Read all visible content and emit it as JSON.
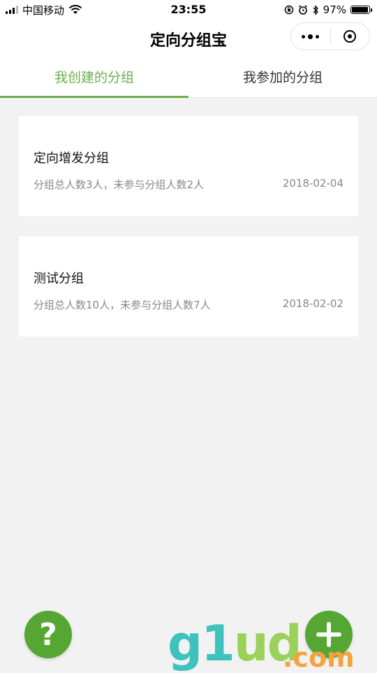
{
  "status_bar": {
    "carrier": "中国移动",
    "time": "23:55",
    "battery_percent": "97%",
    "battery_level": 0.97,
    "icons": [
      "signal-icon",
      "wifi-icon",
      "orientation-lock-icon",
      "alarm-icon",
      "bluetooth-icon",
      "battery-icon"
    ]
  },
  "navbar": {
    "title": "定向分组宝",
    "more_icon": "more-dots-icon",
    "close_icon": "target-icon"
  },
  "tabs": [
    {
      "label": "我创建的分组",
      "active": true
    },
    {
      "label": "我参加的分组",
      "active": false
    }
  ],
  "groups": [
    {
      "title": "定向增发分组",
      "summary": "分组总人数3人，未参与分组人数2人",
      "date": "2018-02-04"
    },
    {
      "title": "测试分组",
      "summary": "分组总人数10人，未参与分组人数7人",
      "date": "2018-02-02"
    }
  ],
  "buttons": {
    "help_label": "?"
  },
  "watermark": {
    "g": "g",
    "l": "1",
    "u": "u",
    "d": "d",
    "dot_com": ".com"
  },
  "colors": {
    "accent": "#6ab04c",
    "fab": "#55a632",
    "background": "#f2f2f2",
    "card": "#ffffff",
    "secondary_text": "#888888"
  }
}
